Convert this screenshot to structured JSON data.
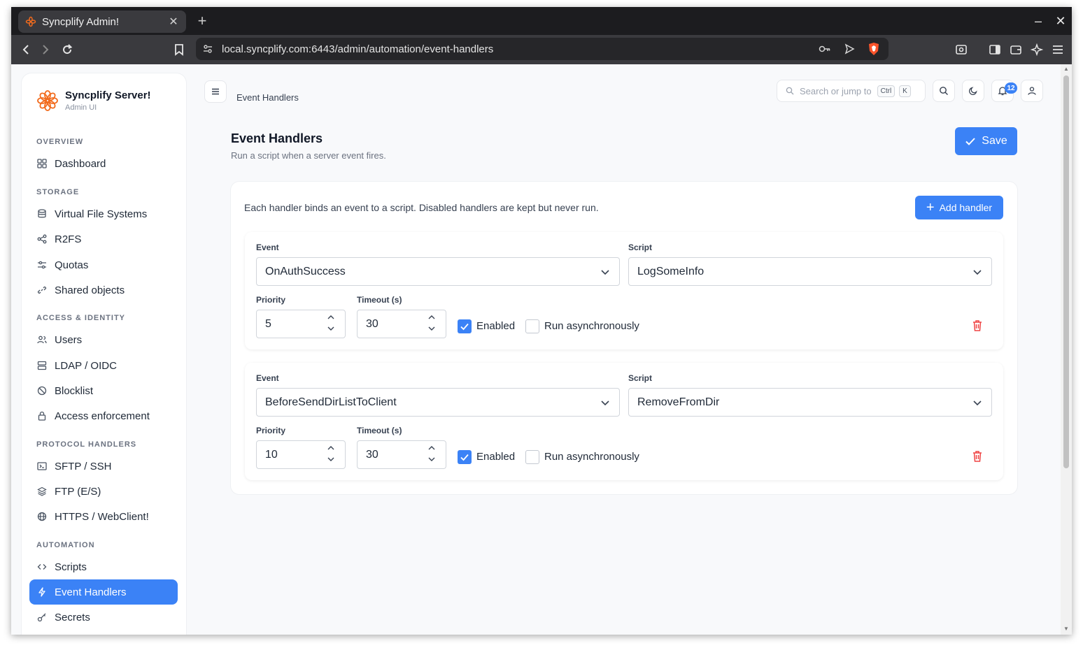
{
  "browser": {
    "tab_title": "Syncplify Admin!",
    "url": "local.syncplify.com:6443/admin/automation/event-handlers"
  },
  "brand": {
    "title": "Syncplify Server!",
    "subtitle": "Admin UI",
    "accent": "#f26b1d"
  },
  "sidebar": {
    "sections": {
      "overview": "OVERVIEW",
      "storage": "STORAGE",
      "access": "ACCESS & IDENTITY",
      "protocol": "PROTOCOL HANDLERS",
      "automation": "AUTOMATION"
    },
    "items": {
      "dashboard": "Dashboard",
      "vfs": "Virtual File Systems",
      "r2fs": "R2FS",
      "quotas": "Quotas",
      "shared": "Shared objects",
      "users": "Users",
      "ldap": "LDAP / OIDC",
      "blocklist": "Blocklist",
      "access_enforcement": "Access enforcement",
      "sftp": "SFTP / SSH",
      "ftp": "FTP (E/S)",
      "https": "HTTPS / WebClient!",
      "scripts": "Scripts",
      "event_handlers": "Event Handlers",
      "secrets": "Secrets"
    }
  },
  "header": {
    "breadcrumb": "Event Handlers",
    "search_placeholder": "Search or jump to",
    "kbd_ctrl": "Ctrl",
    "kbd_k": "K",
    "notification_count": "12"
  },
  "main": {
    "title": "Event Handlers",
    "subtitle": "Run a script when a server event fires.",
    "save_label": "Save",
    "description": "Each handler binds an event to a script. Disabled handlers are kept but never run.",
    "add_label": "Add handler",
    "labels": {
      "event": "Event",
      "script": "Script",
      "priority": "Priority",
      "timeout": "Timeout (s)",
      "enabled": "Enabled",
      "async": "Run asynchronously"
    },
    "handlers": [
      {
        "event": "OnAuthSuccess",
        "script": "LogSomeInfo",
        "priority": "5",
        "timeout": "30",
        "enabled": true,
        "async": false
      },
      {
        "event": "BeforeSendDirListToClient",
        "script": "RemoveFromDir",
        "priority": "10",
        "timeout": "30",
        "enabled": true,
        "async": false
      }
    ]
  },
  "colors": {
    "primary": "#3b82f6",
    "danger": "#ef4444"
  }
}
